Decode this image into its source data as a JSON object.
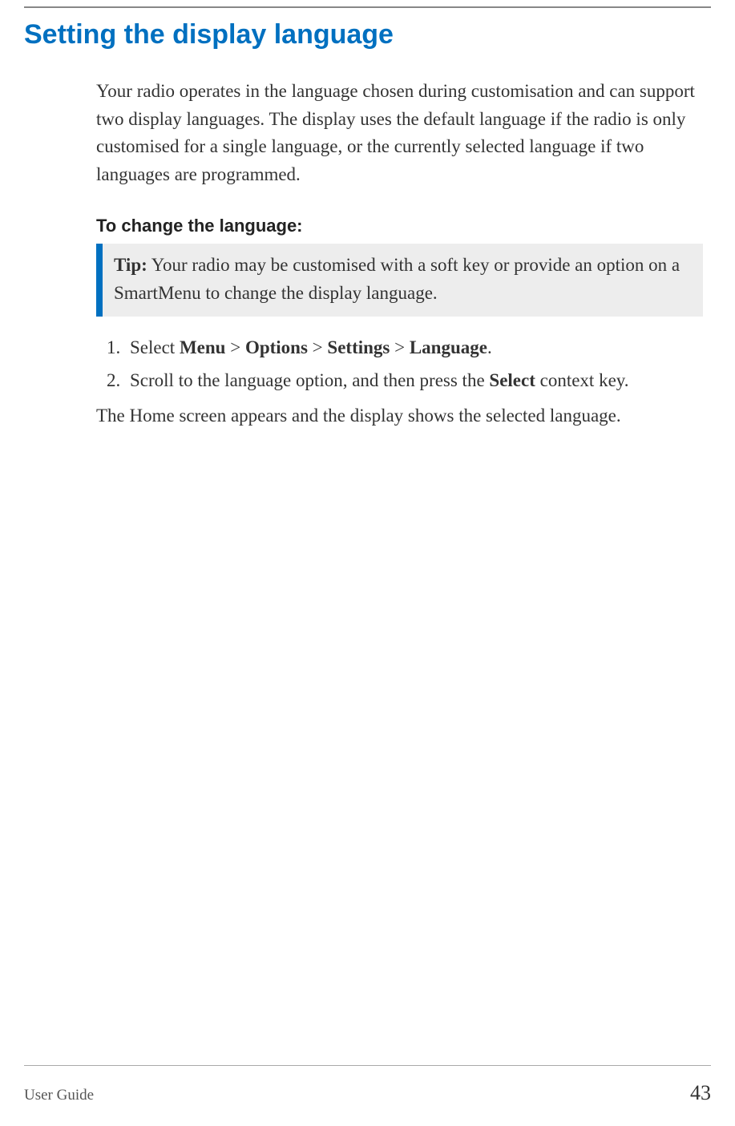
{
  "title": "Setting the display language",
  "intro": "Your radio operates in the language chosen during customisation and can support two display languages. The display uses the default language if the radio is only customised for a single language, or the currently selected language if two languages are programmed.",
  "subhead": "To change the language:",
  "tip": {
    "label": "Tip:",
    "text": "Your radio may be customised with a soft key or provide an option on a SmartMenu to change the display language."
  },
  "steps": {
    "step1": {
      "prefix": "Select ",
      "menu": "Menu",
      "sep": " > ",
      "options": "Options",
      "settings": "Settings",
      "language": "Language",
      "suffix": "."
    },
    "step2": {
      "prefix": "Scroll to the language option, and then press the ",
      "select": "Select",
      "suffix": " context key."
    }
  },
  "result": "The Home screen appears and the display shows the selected language.",
  "footer": {
    "doc": "User Guide",
    "page": "43"
  }
}
